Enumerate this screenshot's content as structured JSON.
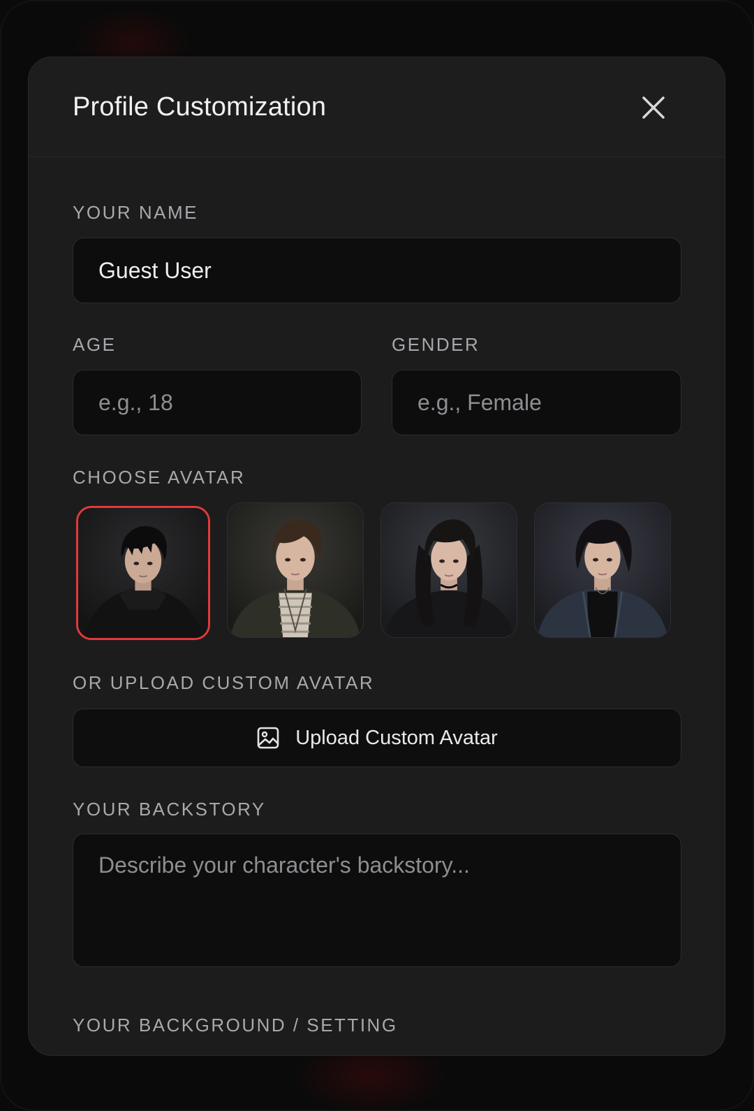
{
  "modal": {
    "title": "Profile Customization",
    "close_icon": "close-icon"
  },
  "name_section": {
    "label": "YOUR NAME",
    "value": "Guest User",
    "placeholder": ""
  },
  "age_section": {
    "label": "AGE",
    "value": "",
    "placeholder": "e.g., 18"
  },
  "gender_section": {
    "label": "GENDER",
    "value": "",
    "placeholder": "e.g., Female"
  },
  "avatar_section": {
    "label": "CHOOSE AVATAR",
    "selected_index": 0,
    "selected_color": "#e03a3a",
    "avatars": [
      {
        "icon": "avatar-boy-black-hoodie"
      },
      {
        "icon": "avatar-boy-olive-jacket"
      },
      {
        "icon": "avatar-girl-black-hoodie"
      },
      {
        "icon": "avatar-girl-denim-jacket"
      }
    ]
  },
  "upload_section": {
    "label": "OR UPLOAD CUSTOM AVATAR",
    "button_label": "Upload Custom Avatar",
    "button_icon": "image-icon"
  },
  "backstory_section": {
    "label": "YOUR BACKSTORY",
    "value": "",
    "placeholder": "Describe your character's backstory..."
  },
  "background_section": {
    "label": "YOUR BACKGROUND / SETTING"
  }
}
